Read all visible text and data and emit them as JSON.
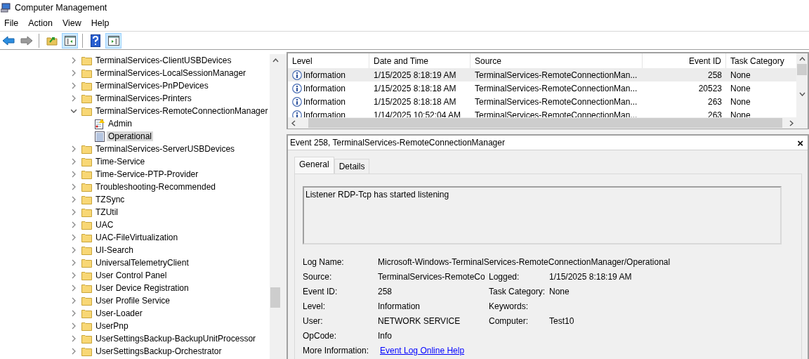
{
  "window": {
    "title": "Computer Management"
  },
  "menu": [
    "File",
    "Action",
    "View",
    "Help"
  ],
  "toolbar": [
    {
      "kind": "back"
    },
    {
      "kind": "forward"
    },
    {
      "kind": "sep"
    },
    {
      "kind": "up"
    },
    {
      "kind": "tree",
      "on": true
    },
    {
      "kind": "sep"
    },
    {
      "kind": "help"
    },
    {
      "kind": "pane",
      "on": true
    }
  ],
  "tree": {
    "items": [
      {
        "label": "TerminalServices-ClientUSBDevices",
        "kind": "folder",
        "expanded": false,
        "selected": false
      },
      {
        "label": "TerminalServices-LocalSessionManager",
        "kind": "folder",
        "expanded": false,
        "selected": false
      },
      {
        "label": "TerminalServices-PnPDevices",
        "kind": "folder",
        "expanded": false,
        "selected": false
      },
      {
        "label": "TerminalServices-Printers",
        "kind": "folder",
        "expanded": false,
        "selected": false
      },
      {
        "label": "TerminalServices-RemoteConnectionManager",
        "kind": "folder",
        "expanded": true,
        "selected": false,
        "children": [
          {
            "label": "Admin",
            "kind": "admin-log",
            "selected": false
          },
          {
            "label": "Operational",
            "kind": "log",
            "selected": true
          }
        ]
      },
      {
        "label": "TerminalServices-ServerUSBDevices",
        "kind": "folder",
        "expanded": false,
        "selected": false
      },
      {
        "label": "Time-Service",
        "kind": "folder",
        "expanded": false,
        "selected": false
      },
      {
        "label": "Time-Service-PTP-Provider",
        "kind": "folder",
        "expanded": false,
        "selected": false
      },
      {
        "label": "Troubleshooting-Recommended",
        "kind": "folder",
        "expanded": false,
        "selected": false
      },
      {
        "label": "TZSync",
        "kind": "folder",
        "expanded": false,
        "selected": false
      },
      {
        "label": "TZUtil",
        "kind": "folder",
        "expanded": false,
        "selected": false
      },
      {
        "label": "UAC",
        "kind": "folder",
        "expanded": false,
        "selected": false
      },
      {
        "label": "UAC-FileVirtualization",
        "kind": "folder",
        "expanded": false,
        "selected": false
      },
      {
        "label": "UI-Search",
        "kind": "folder",
        "expanded": false,
        "selected": false
      },
      {
        "label": "UniversalTelemetryClient",
        "kind": "folder",
        "expanded": false,
        "selected": false
      },
      {
        "label": "User Control Panel",
        "kind": "folder",
        "expanded": false,
        "selected": false
      },
      {
        "label": "User Device Registration",
        "kind": "folder",
        "expanded": false,
        "selected": false
      },
      {
        "label": "User Profile Service",
        "kind": "folder",
        "expanded": false,
        "selected": false
      },
      {
        "label": "User-Loader",
        "kind": "folder",
        "expanded": false,
        "selected": false
      },
      {
        "label": "UserPnp",
        "kind": "folder",
        "expanded": false,
        "selected": false
      },
      {
        "label": "UserSettingsBackup-BackupUnitProcessor",
        "kind": "folder",
        "expanded": false,
        "selected": false
      },
      {
        "label": "UserSettingsBackup-Orchestrator",
        "kind": "folder",
        "expanded": false,
        "selected": false
      }
    ]
  },
  "events": {
    "columns": [
      "Level",
      "Date and Time",
      "Source",
      "Event ID",
      "Task Category"
    ],
    "rows": [
      {
        "level": "Information",
        "date": "1/15/2025 8:18:19 AM",
        "source": "TerminalServices-RemoteConnectionMan...",
        "event_id": "258",
        "task_category": "None",
        "selected": true
      },
      {
        "level": "Information",
        "date": "1/15/2025 8:18:18 AM",
        "source": "TerminalServices-RemoteConnectionMan...",
        "event_id": "20523",
        "task_category": "None",
        "selected": false
      },
      {
        "level": "Information",
        "date": "1/15/2025 8:18:18 AM",
        "source": "TerminalServices-RemoteConnectionMan...",
        "event_id": "263",
        "task_category": "None",
        "selected": false
      },
      {
        "level": "Information",
        "date": "1/14/2025 10:52:04 AM",
        "source": "TerminalServices-RemoteConnectionMan...",
        "event_id": "263",
        "task_category": "None",
        "selected": false
      }
    ]
  },
  "detail": {
    "title": "Event 258, TerminalServices-RemoteConnectionManager",
    "close": "×",
    "tabs": [
      {
        "label": "General",
        "selected": true
      },
      {
        "label": "Details",
        "selected": false
      }
    ],
    "message": "Listener RDP-Tcp has started listening",
    "fields": [
      [
        {
          "label": "Log Name:",
          "value": "Microsoft-Windows-TerminalServices-RemoteConnectionManager/Operational",
          "kind": "text"
        }
      ],
      [
        {
          "label": "Source:",
          "value": "TerminalServices-RemoteCo",
          "kind": "text"
        },
        {
          "label": "Logged:",
          "value": "1/15/2025 8:18:19 AM",
          "kind": "text"
        }
      ],
      [
        {
          "label": "Event ID:",
          "value": "258",
          "kind": "text"
        },
        {
          "label": "Task Category:",
          "value": "None",
          "kind": "text"
        }
      ],
      [
        {
          "label": "Level:",
          "value": "Information",
          "kind": "text"
        },
        {
          "label": "Keywords:"
        }
      ],
      [
        {
          "label": "User:",
          "value": "NETWORK SERVICE",
          "kind": "text"
        },
        {
          "label": "Computer:",
          "value": "Test10",
          "kind": "text"
        }
      ],
      [
        {
          "label": "OpCode:",
          "value": "Info",
          "kind": "text"
        }
      ],
      [
        {
          "label": "More Information:",
          "value": "Event Log Online Help",
          "kind": "link"
        }
      ]
    ]
  }
}
